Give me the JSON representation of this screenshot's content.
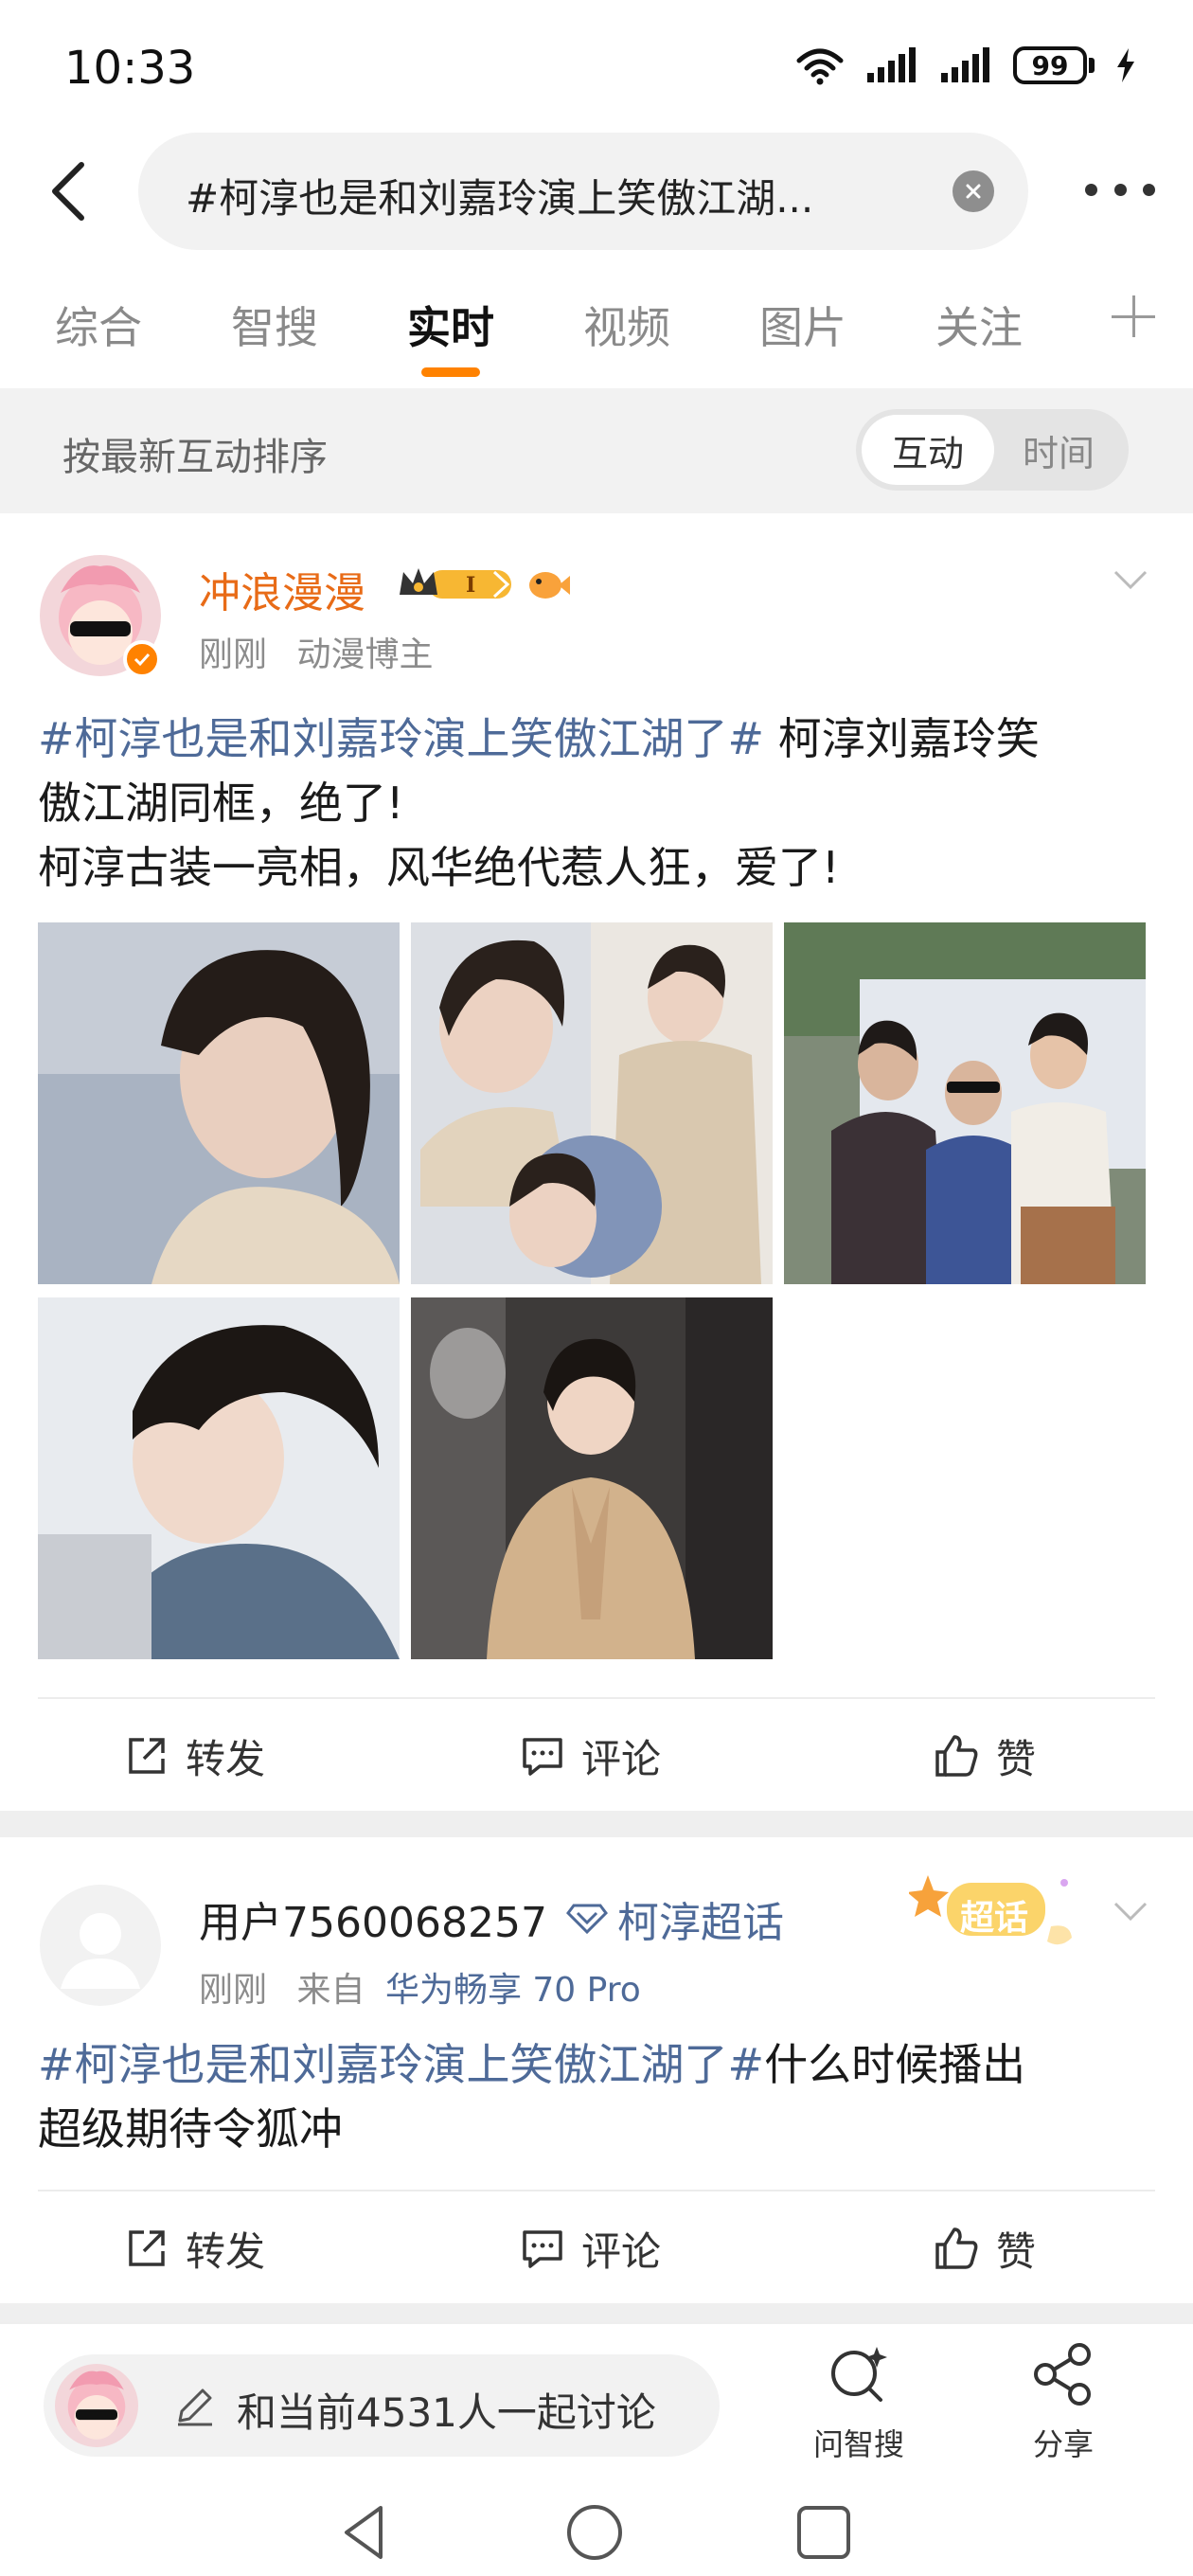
{
  "status": {
    "time": "10:33",
    "battery": "99"
  },
  "search": {
    "query": "#柯淳也是和刘嘉玲演上笑傲江湖..."
  },
  "tabs": [
    "综合",
    "智搜",
    "实时",
    "视频",
    "图片",
    "关注"
  ],
  "active_tab": "实时",
  "sort": {
    "label": "按最新互动排序",
    "options": [
      "互动",
      "时间"
    ],
    "selected": "互动"
  },
  "posts": [
    {
      "username": "冲浪漫漫",
      "time": "刚刚",
      "tagline": "动漫博主",
      "hashtag": "#柯淳也是和刘嘉玲演上笑傲江湖了#",
      "text_line1_rest": " 柯淳刘嘉玲笑",
      "text_line2": "傲江湖同框，绝了!",
      "text_line3": "柯淳古装一亮相，风华绝代惹人狂，爱了!",
      "photo_count": 5,
      "actions": {
        "repost": "转发",
        "comment": "评论",
        "like": "赞"
      }
    },
    {
      "username": "用户7560068257",
      "supertopic": "柯淳超话",
      "sticker": "超话",
      "time": "刚刚",
      "from_label": "来自",
      "device": "华为畅享 70 Pro",
      "hashtag": "#柯淳也是和刘嘉玲演上笑傲江湖了#",
      "text_rest": "什么时候播出",
      "text_line2": "超级期待令狐冲",
      "actions": {
        "repost": "转发",
        "comment": "评论",
        "like": "赞"
      }
    }
  ],
  "bottom": {
    "discuss": "和当前4531人一起讨论",
    "smart_search": "问智搜",
    "share": "分享"
  },
  "colors": {
    "accent": "#ff8200",
    "link": "#4e6a98",
    "username_vip": "#e86b17"
  }
}
